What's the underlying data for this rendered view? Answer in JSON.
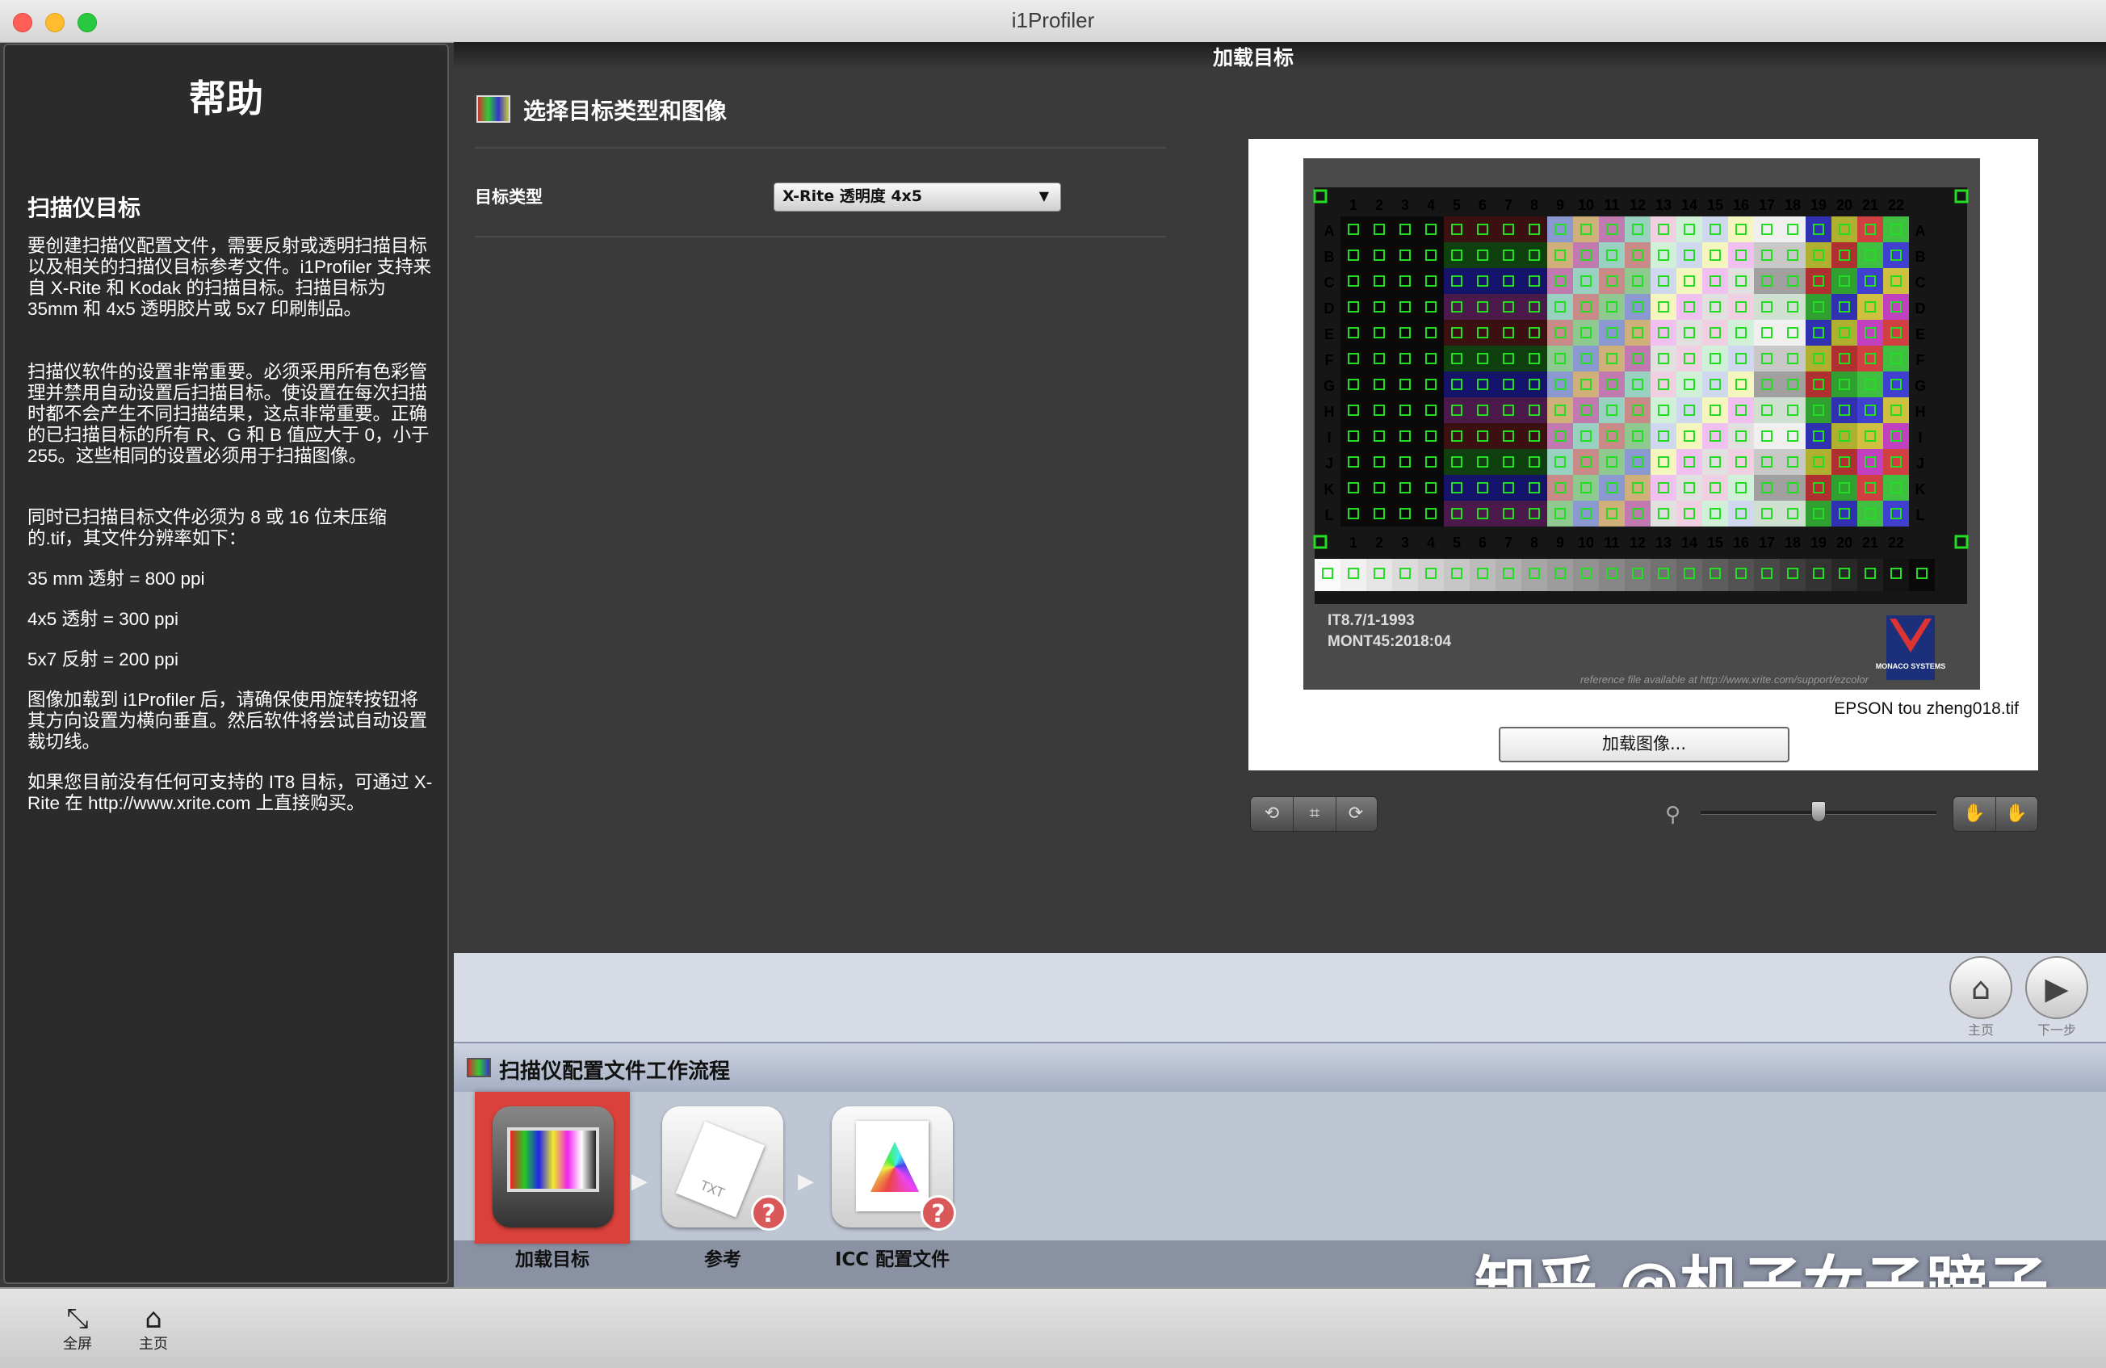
{
  "window": {
    "title": "i1Profiler"
  },
  "help": {
    "title": "帮助",
    "subtitle": "扫描仪目标",
    "paragraphs": [
      "要创建扫描仪配置文件，需要反射或透明扫描目标以及相关的扫描仪目标参考文件。i1Profiler 支持来自 X-Rite 和 Kodak 的扫描目标。扫描目标为 35mm 和 4x5 透明胶片或 5x7 印刷制品。",
      "扫描仪软件的设置非常重要。必须采用所有色彩管理并禁用自动设置后扫描目标。使设置在每次扫描时都不会产生不同扫描结果，这点非常重要。正确的已扫描目标的所有 R、G 和 B 值应大于 0，小于 255。这些相同的设置必须用于扫描图像。",
      "同时已扫描目标文件必须为 8 或 16 位未压缩的.tif，其文件分辨率如下：",
      "35 mm 透射 = 800 ppi",
      "4x5 透射 = 300 ppi",
      "5x7 反射 = 200 ppi",
      "图像加载到 i1Profiler 后，请确保使用旋转按钮将其方向设置为横向垂直。然后软件将尝试自动设置裁切线。",
      "如果您目前没有任何可支持的 IT8 目标，可通过 X-Rite 在 http://www.xrite.com 上直接购买。"
    ]
  },
  "header": {
    "title": "加载目标"
  },
  "main": {
    "section_title": "选择目标类型和图像",
    "target_type_label": "目标类型",
    "target_type_value": "X-Rite 透明度 4x5",
    "filename": "EPSON tou zheng018.tif",
    "load_button": "加载图像...",
    "target_caption_1": "IT8.7/1-1993",
    "target_caption_2": "MONT45:2018:04",
    "target_reference_note": "reference file available at http://www.xrite.com/support/ezcolor",
    "logo_text": "MONACO SYSTEMS",
    "grid_rows": [
      "A",
      "B",
      "C",
      "D",
      "E",
      "F",
      "G",
      "H",
      "I",
      "J",
      "K",
      "L"
    ],
    "grid_cols": [
      "1",
      "2",
      "3",
      "4",
      "5",
      "6",
      "7",
      "8",
      "9",
      "10",
      "11",
      "12",
      "13",
      "14",
      "15",
      "16",
      "17",
      "18",
      "19",
      "20",
      "21",
      "22"
    ]
  },
  "controls": {
    "left_icons": [
      "rotate-ccw-icon",
      "crop-icon",
      "rotate-cw-icon"
    ],
    "zoom_icon": "magnifier-icon",
    "zoom_level": 0.5,
    "right_icons": [
      "hand-left-icon",
      "hand-right-icon"
    ]
  },
  "nav": {
    "home_label": "主页",
    "next_label": "下一步"
  },
  "workflow": {
    "title": "扫描仪配置文件工作流程",
    "steps": [
      {
        "label": "加载目标"
      },
      {
        "label": "参考"
      },
      {
        "label": "ICC 配置文件"
      }
    ],
    "help_mark": "?"
  },
  "bottom": {
    "fullscreen_label": "全屏",
    "home_label": "主页"
  },
  "watermark": "知乎 @机子女子蹄子",
  "colors": {
    "accent_red": "#d9413a",
    "panel_dark": "#2b2b2b",
    "workflow_bg": "#bfc6d3",
    "grid_green": "#22dd22"
  }
}
